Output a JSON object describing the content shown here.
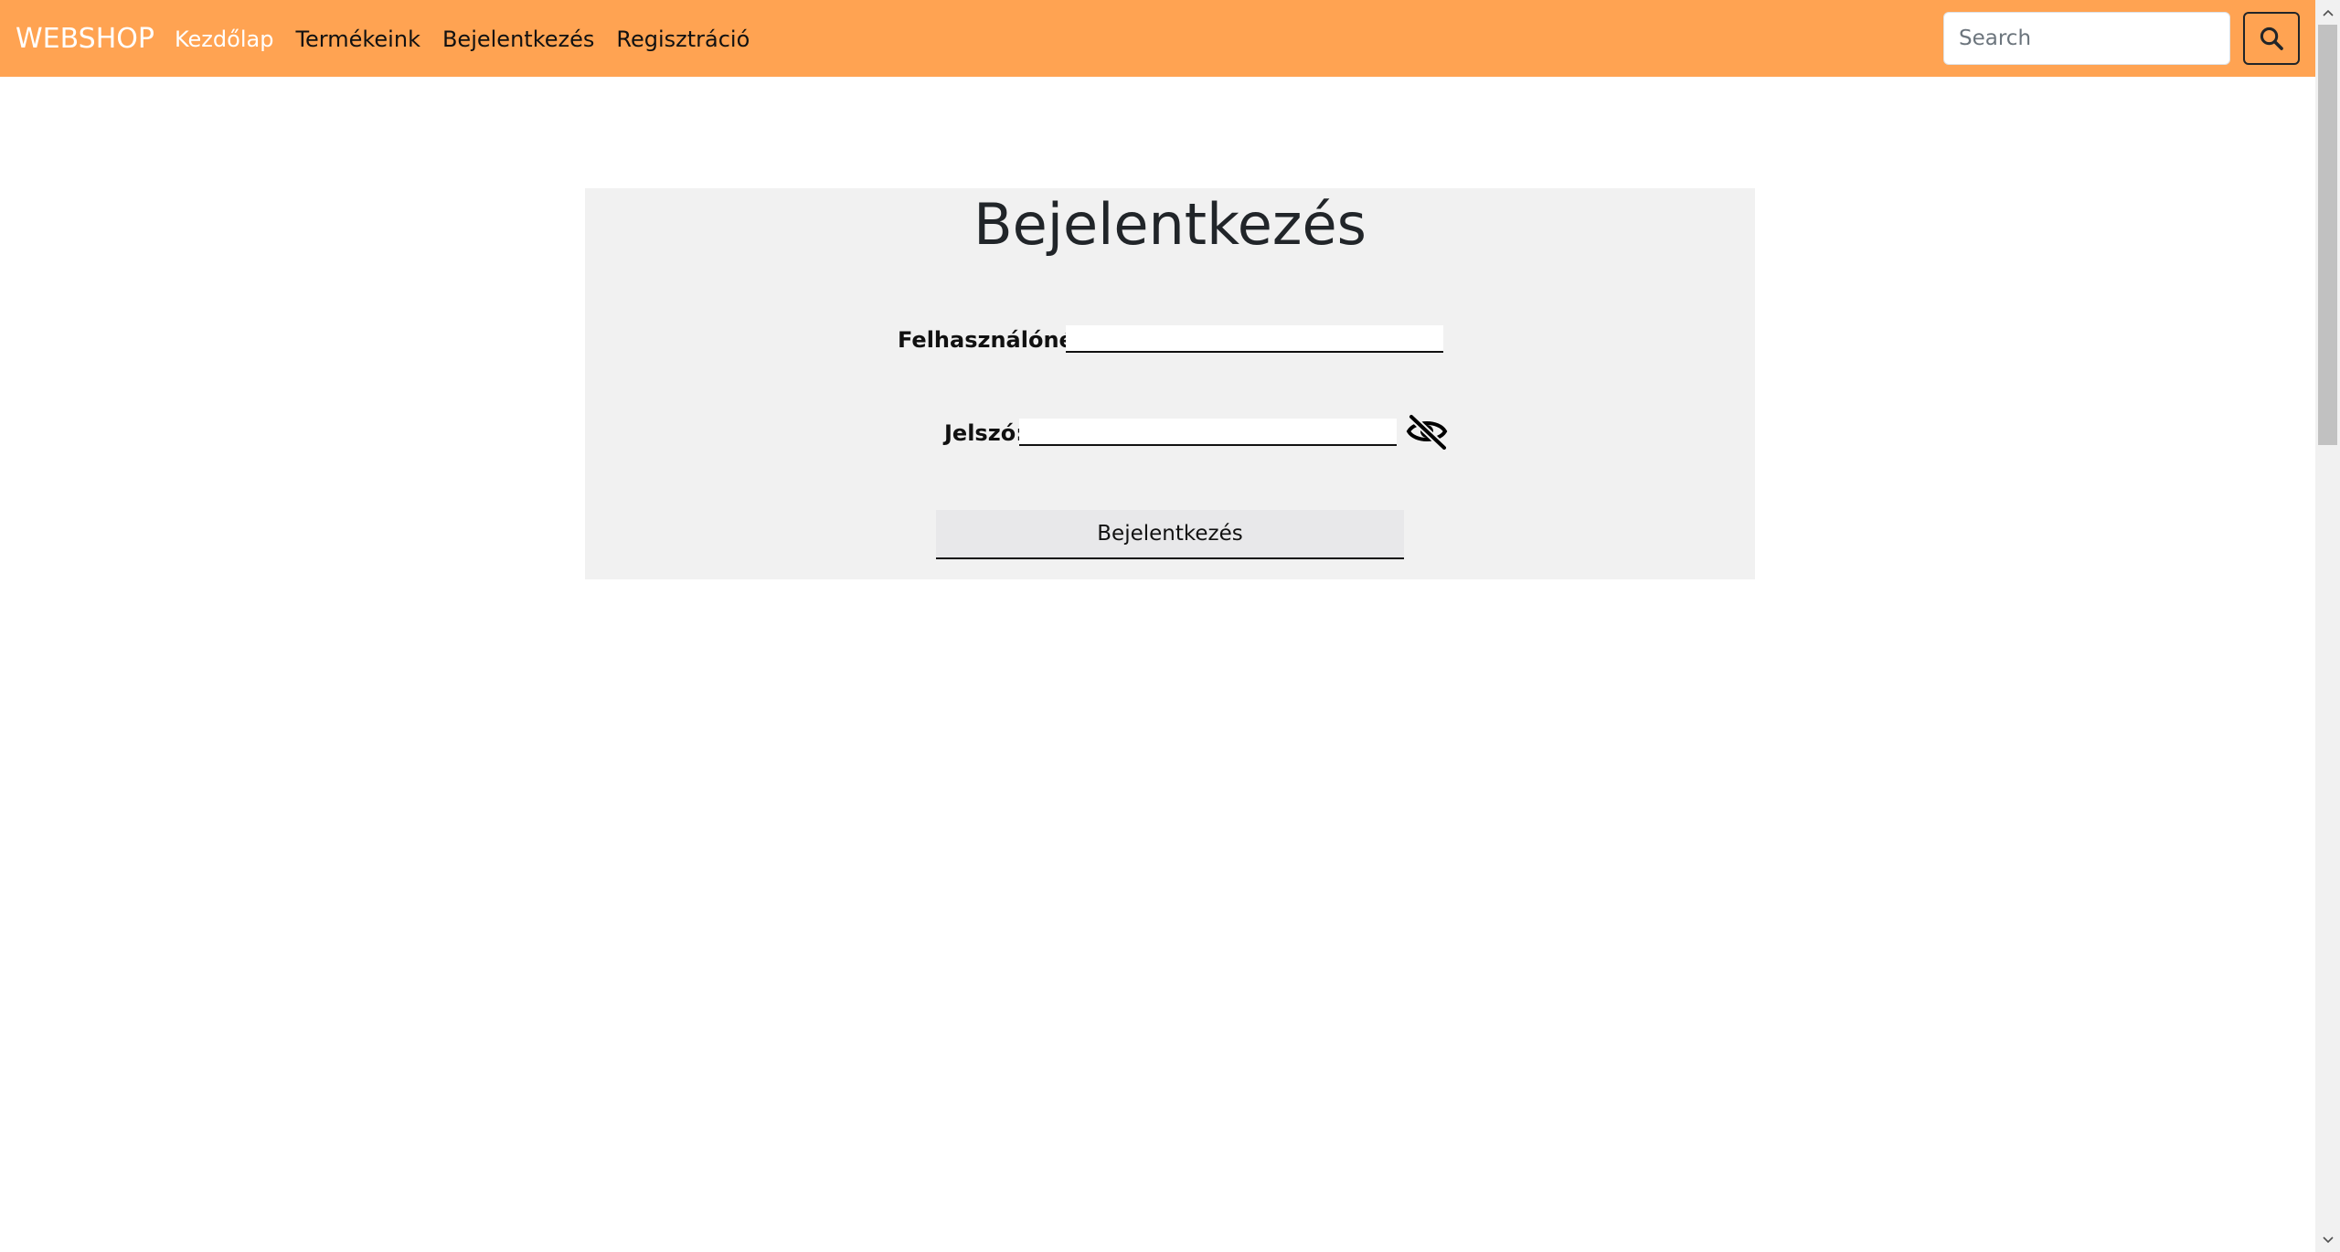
{
  "navbar": {
    "brand": "WEBSHOP",
    "links": [
      {
        "label": "Kezdőlap",
        "active": true
      },
      {
        "label": "Termékeink",
        "active": false
      },
      {
        "label": "Bejelentkezés",
        "active": false
      },
      {
        "label": "Regisztráció",
        "active": false
      }
    ],
    "search": {
      "placeholder": "Search",
      "value": "",
      "button_icon": "search-icon"
    },
    "background_color": "#ffa352"
  },
  "login": {
    "title": "Bejelentkezés",
    "username_label": "Felhasználónév:",
    "username_value": "",
    "password_label": "Jelszó:",
    "password_value": "",
    "toggle_icon": "eye-slash-icon",
    "submit_label": "Bejelentkezés"
  }
}
